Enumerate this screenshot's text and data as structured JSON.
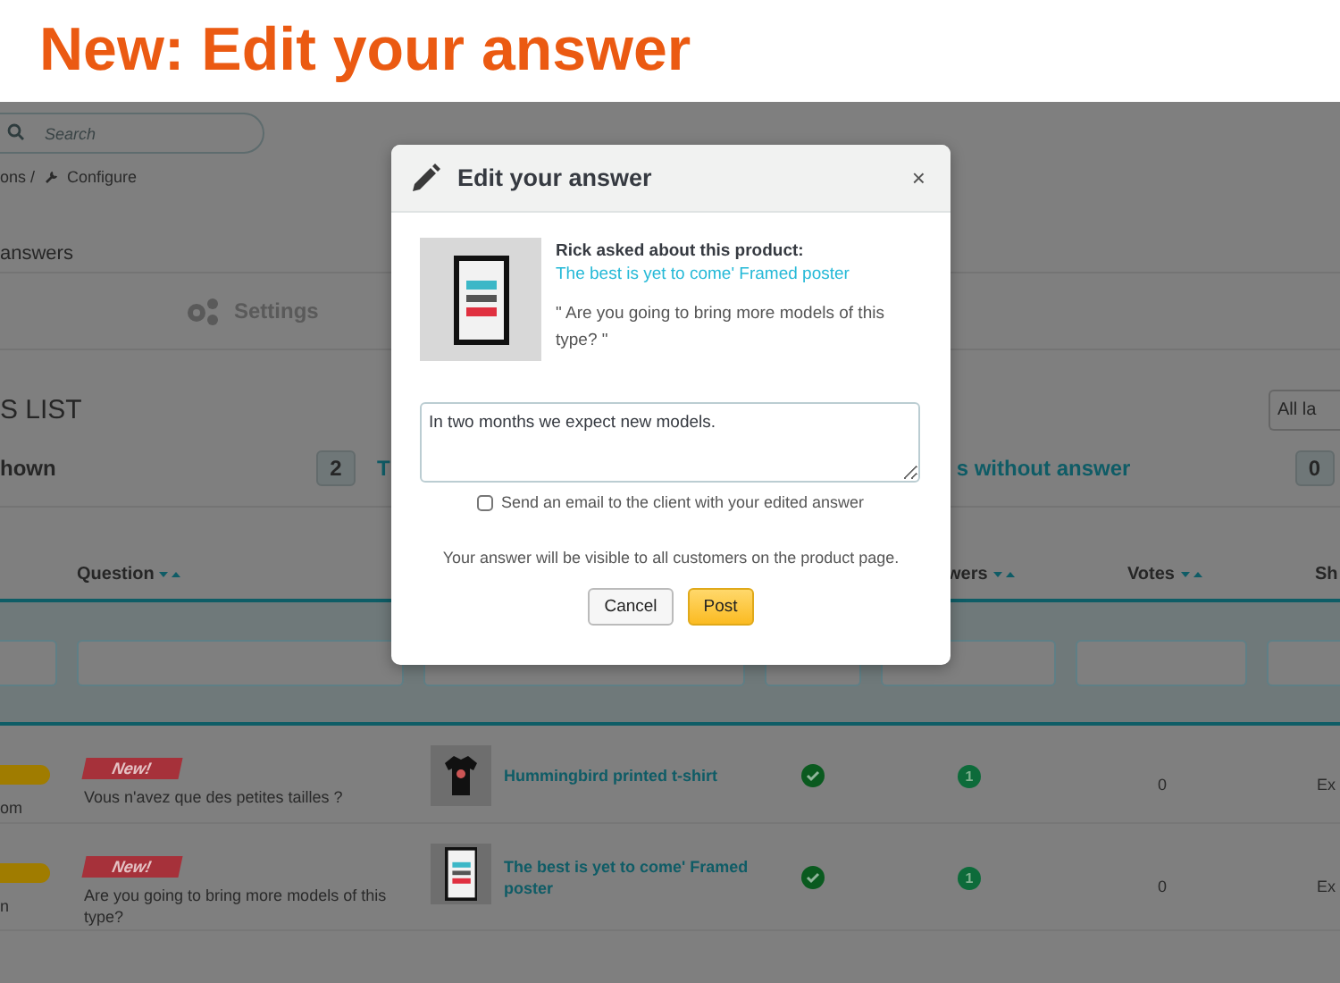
{
  "banner": {
    "title": "New: Edit your answer"
  },
  "page": {
    "search": {
      "placeholder": "Search"
    },
    "breadcrumb": [
      "ons /",
      "Configure"
    ],
    "tab_label": "answers",
    "settings_tab": "Settings",
    "section_title": "S LIST",
    "language_select": "All la",
    "stats": {
      "shown_label": "hown",
      "shown_count": "2",
      "link_1": "T",
      "link_2": "s without answer",
      "count_2": "0"
    },
    "table": {
      "columns": [
        {
          "label": "Question",
          "sort": true
        },
        {
          "label": "wers",
          "sort": true
        },
        {
          "label": "Votes",
          "sort": true
        },
        {
          "label": "Sh",
          "sort": false
        }
      ],
      "rows": [
        {
          "customer": "om",
          "badge": "New!",
          "question": "Vous n'avez que des petites tailles ?",
          "kind": "tshirt",
          "product": "Hummingbird printed t-shirt",
          "approved": true,
          "answers": "1",
          "votes": "0",
          "shown": "Ex"
        },
        {
          "customer": "n",
          "badge": "New!",
          "question": "Are you going to bring more models of this type?",
          "kind": "poster",
          "product": "The best is yet to come' Framed poster",
          "approved": true,
          "answers": "1",
          "votes": "0",
          "shown": "Ex"
        }
      ]
    }
  },
  "modal": {
    "title": "Edit your answer",
    "close": "×",
    "asker": "Rick asked about this product:",
    "product_link": "The best is yet to come' Framed poster",
    "quote": "\" Are you going to bring more models of this type? \"",
    "answer": "In two months we expect new models.",
    "email_option": {
      "label": "Send an email to the client with your edited answer",
      "checked": false
    },
    "note": "Your answer will be visible to all customers on the product page.",
    "buttons": [
      {
        "label": "Cancel",
        "kind": "secondary"
      },
      {
        "label": "Post",
        "kind": "primary"
      }
    ]
  }
}
